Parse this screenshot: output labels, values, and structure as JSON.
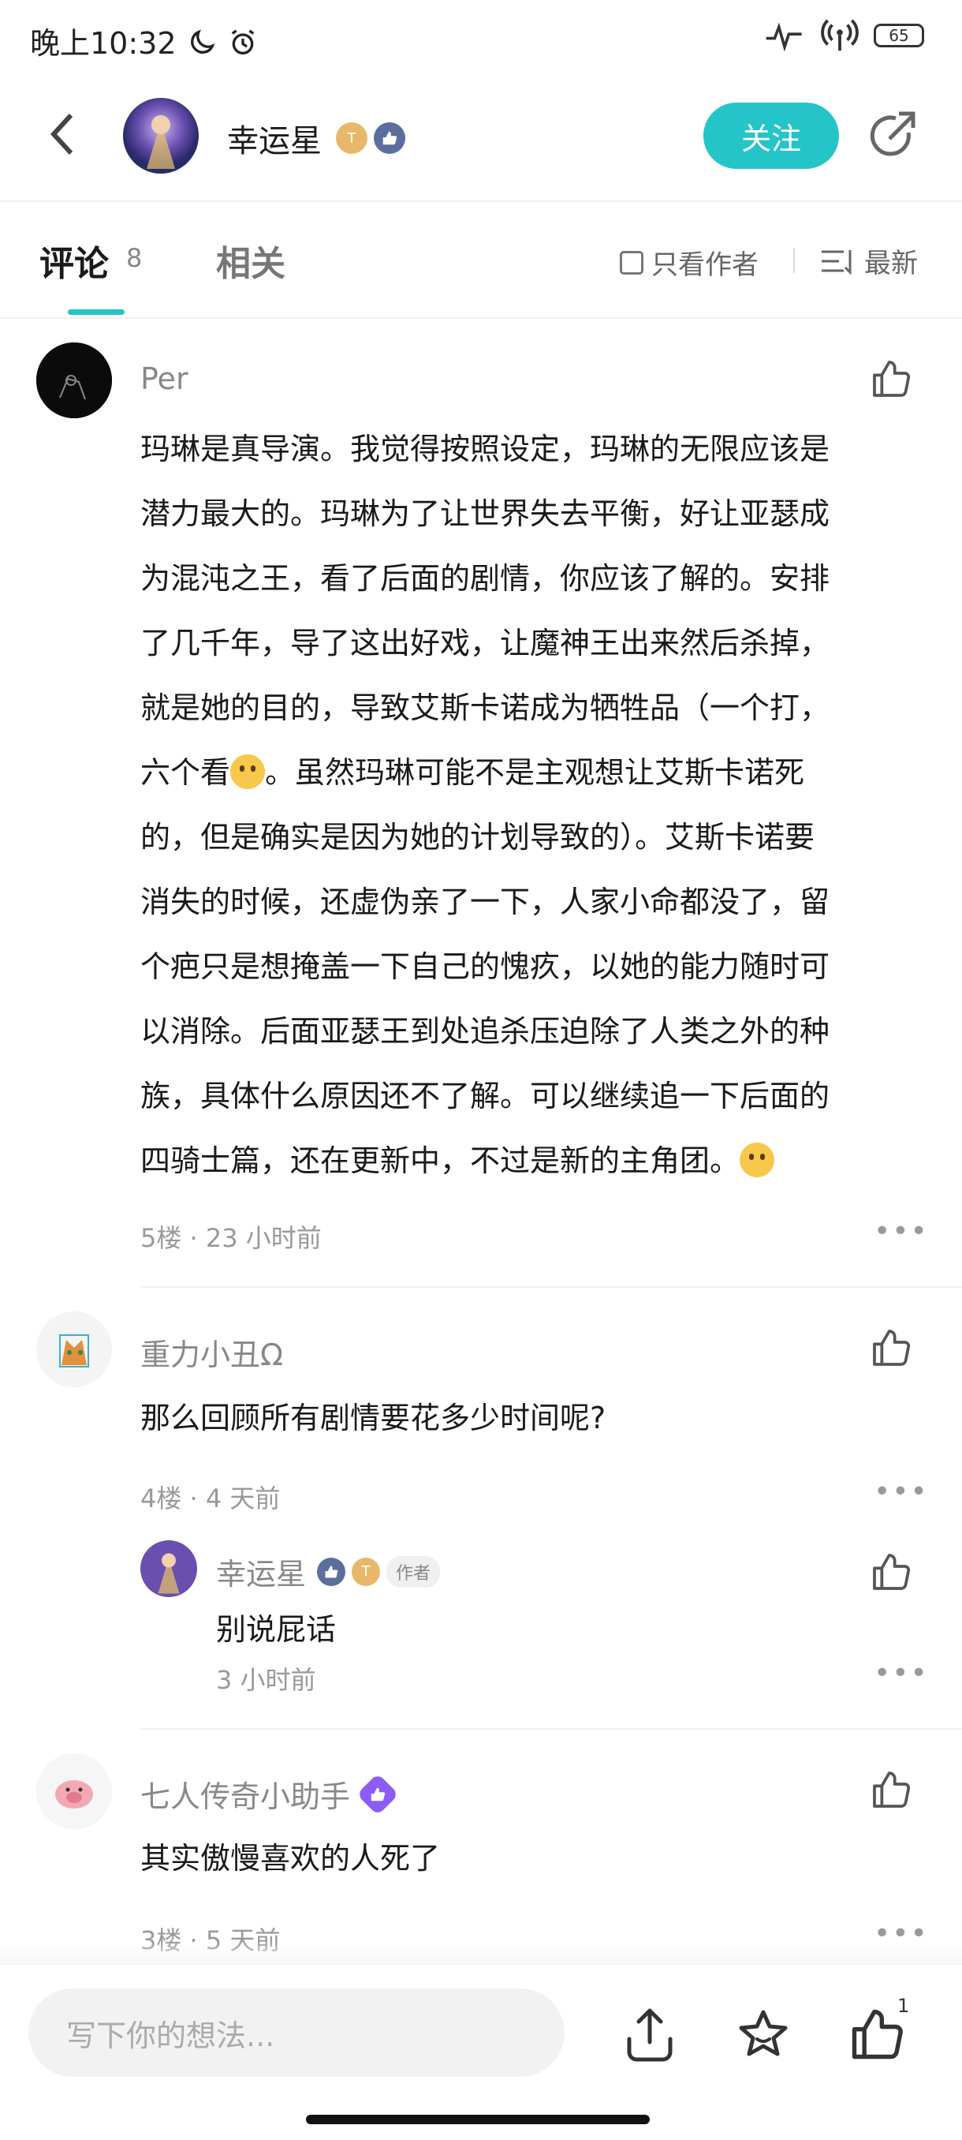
{
  "status_bar": {
    "time": "晚上10:32",
    "battery": "65"
  },
  "header": {
    "author_name": "幸运星",
    "badge_t": "T",
    "follow_label": "关注"
  },
  "tabs": {
    "comments_label": "评论",
    "comments_count": "8",
    "related_label": "相关",
    "only_author_label": "只看作者",
    "sort_label": "最新"
  },
  "comments": [
    {
      "user": "Per",
      "text_lines": [
        "玛琳是真导演。我觉得按照设定，玛琳的无限应该是",
        "潜力最大的。玛琳为了让世界失去平衡，好让亚瑟成",
        "为混沌之王，看了后面的剧情，你应该了解的。安排",
        "了几千年，导了这出好戏，让魔神王出来然后杀掉，",
        "就是她的目的，导致艾斯卡诺成为牺牲品（一个打，",
        "六个看",
        "。虽然玛琳可能不是主观想让艾斯卡诺死",
        "的，但是确实是因为她的计划导致的）。艾斯卡诺要",
        "消失的时候，还虚伪亲了一下，人家小命都没了，留",
        "个疤只是想掩盖一下自己的愧疚，以她的能力随时可",
        "以消除。后面亚瑟王到处追杀压迫除了人类之外的种",
        "族，具体什么原因还不了解。可以继续追一下后面的",
        "四骑士篇，还在更新中，不过是新的主角团。"
      ],
      "meta": "5楼 · 23 小时前"
    },
    {
      "user": "重力小丑Ω",
      "text": "那么回顾所有剧情要花多少时间呢?",
      "meta": "4楼 · 4 天前",
      "reply": {
        "user": "幸运星",
        "author_tag": "作者",
        "text": "别说屁话",
        "meta": "3 小时前"
      }
    },
    {
      "user": "七人传奇小助手",
      "text": "其实傲慢喜欢的人死了",
      "meta": "3楼 · 5 天前"
    }
  ],
  "bottom_bar": {
    "input_placeholder": "写下你的想法...",
    "like_count": "1"
  },
  "colors": {
    "accent": "#25c4c8",
    "badge_purple": "#8b5cf6",
    "badge_blue": "#5b6e9e",
    "badge_gold": "#e8b86a"
  }
}
